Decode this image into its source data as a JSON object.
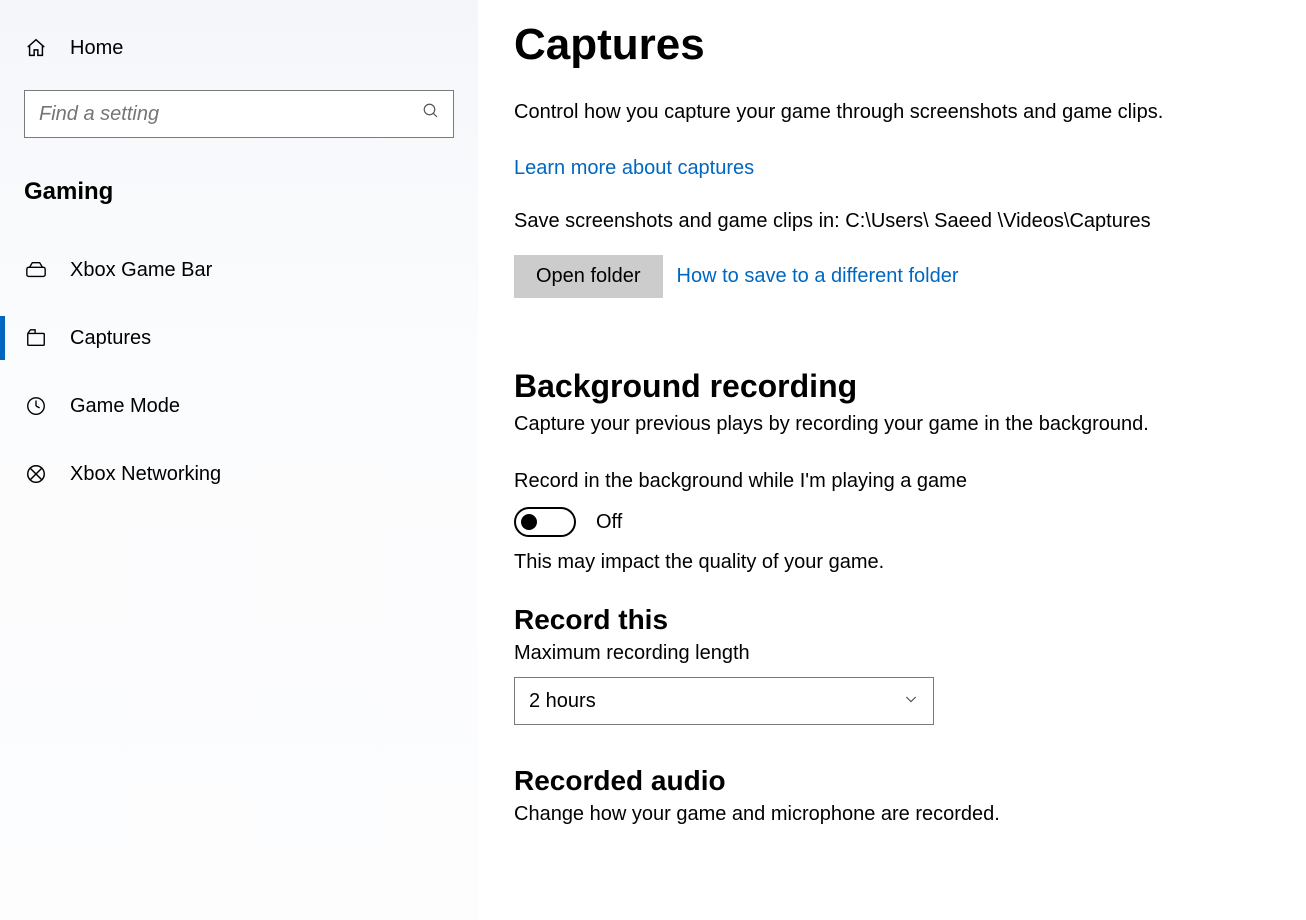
{
  "sidebar": {
    "home_label": "Home",
    "search_placeholder": "Find a setting",
    "section_label": "Gaming",
    "items": [
      {
        "label": "Xbox Game Bar"
      },
      {
        "label": "Captures"
      },
      {
        "label": "Game Mode"
      },
      {
        "label": "Xbox Networking"
      }
    ]
  },
  "main": {
    "title": "Captures",
    "description": "Control how you capture your game through screenshots and game clips.",
    "learn_more": "Learn more about captures",
    "save_path_text": "Save screenshots and game clips in: C:\\Users\\ Saeed \\Videos\\Captures",
    "open_folder_label": "Open folder",
    "how_to_save_link": "How to save to a different folder",
    "bg_heading": "Background recording",
    "bg_desc": "Capture your previous plays by recording your game in the background.",
    "bg_toggle_label": "Record in the background while I'm playing a game",
    "bg_toggle_state": "Off",
    "bg_toggle_note": "This may impact the quality of your game.",
    "record_this_heading": "Record this",
    "max_length_label": "Maximum recording length",
    "max_length_value": "2 hours",
    "recorded_audio_heading": "Recorded audio",
    "recorded_audio_desc": "Change how your game and microphone are recorded."
  }
}
